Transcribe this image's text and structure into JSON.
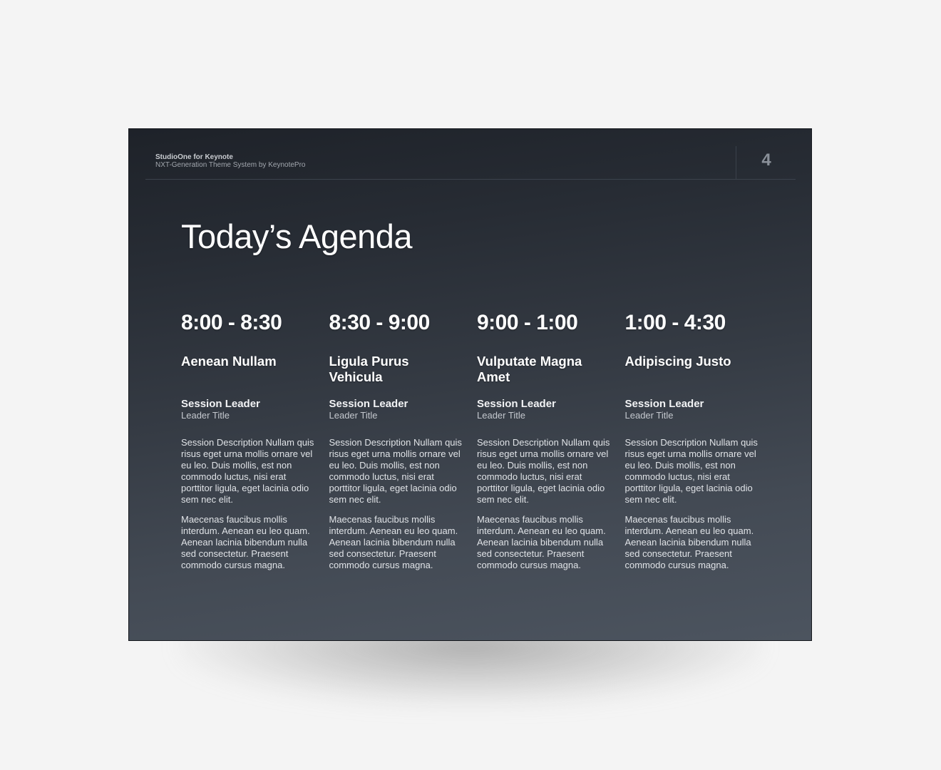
{
  "slide": {
    "brand_title": "StudioOne for Keynote",
    "brand_subtitle": "NXT-Generation Theme System by KeynotePro",
    "page_number": "4",
    "title": "Today’s Agenda",
    "colors": {
      "background_top": "#1e2229",
      "background_bottom": "#4c545f",
      "text": "#ffffff",
      "muted_text": "#c4c8ce",
      "page_number": "#8a9099",
      "canvas": "#f4f4f4"
    }
  },
  "sessions": [
    {
      "time": "8:00 - 8:30",
      "title": "Aenean Nullam",
      "leader_name": "Session Leader",
      "leader_title": "Leader Title",
      "description_1": "Session Description Nullam quis risus eget urna mollis ornare vel eu leo. Duis mollis, est non commodo luctus, nisi erat porttitor ligula, eget lacinia odio sem nec elit.",
      "description_2": "Maecenas faucibus mollis interdum. Aenean eu leo quam. Aenean lacinia bibendum nulla sed consectetur. Praesent commodo cursus magna."
    },
    {
      "time": "8:30 - 9:00",
      "title": "Ligula Purus Vehicula",
      "leader_name": "Session Leader",
      "leader_title": "Leader Title",
      "description_1": "Session Description Nullam quis risus eget urna mollis ornare vel eu leo. Duis mollis, est non commodo luctus, nisi erat porttitor ligula, eget lacinia odio sem nec elit.",
      "description_2": "Maecenas faucibus mollis interdum. Aenean eu leo quam. Aenean lacinia bibendum nulla sed consectetur. Praesent commodo cursus magna."
    },
    {
      "time": "9:00 - 1:00",
      "title": "Vulputate Magna Amet",
      "leader_name": "Session Leader",
      "leader_title": "Leader Title",
      "description_1": "Session Description Nullam quis risus eget urna mollis ornare vel eu leo. Duis mollis, est non commodo luctus, nisi erat porttitor ligula, eget lacinia odio sem nec elit.",
      "description_2": "Maecenas faucibus mollis interdum. Aenean eu leo quam. Aenean lacinia bibendum nulla sed consectetur. Praesent commodo cursus magna."
    },
    {
      "time": "1:00 - 4:30",
      "title": "Adipiscing Justo",
      "leader_name": "Session Leader",
      "leader_title": "Leader Title",
      "description_1": "Session Description Nullam quis risus eget urna mollis ornare vel eu leo. Duis mollis, est non commodo luctus, nisi erat porttitor ligula, eget lacinia odio sem nec elit.",
      "description_2": "Maecenas faucibus mollis interdum. Aenean eu leo quam. Aenean lacinia bibendum nulla sed consectetur. Praesent commodo cursus magna."
    }
  ]
}
